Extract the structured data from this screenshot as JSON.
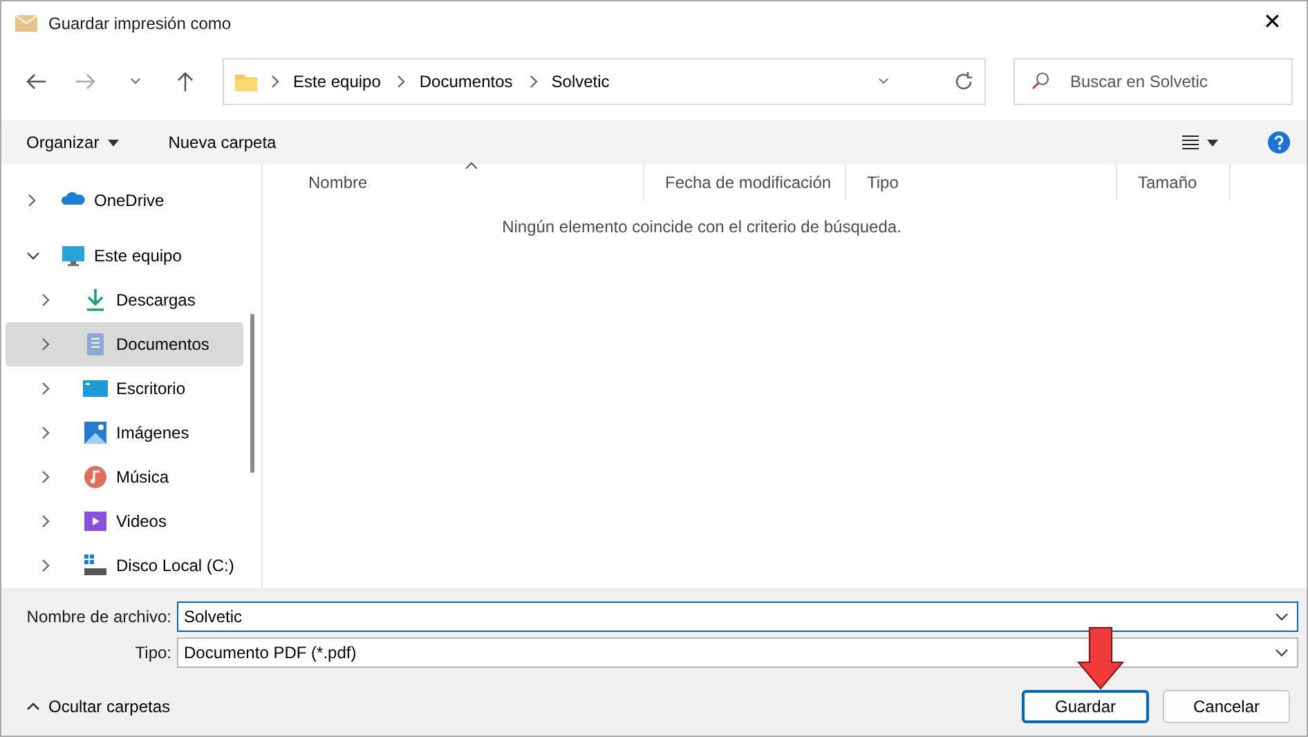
{
  "window": {
    "title": "Guardar impresión como",
    "close": "✕"
  },
  "breadcrumb": [
    "Este equipo",
    "Documentos",
    "Solvetic"
  ],
  "search": {
    "placeholder": "Buscar en Solvetic"
  },
  "toolbar": {
    "organize": "Organizar",
    "new_folder": "Nueva carpeta"
  },
  "sidebar": {
    "items": [
      {
        "label": "OneDrive",
        "expanded": false,
        "selected": false
      },
      {
        "label": "Este equipo",
        "expanded": true,
        "selected": false,
        "children": [
          {
            "label": "Descargas",
            "expanded": false,
            "selected": false
          },
          {
            "label": "Documentos",
            "expanded": false,
            "selected": true
          },
          {
            "label": "Escritorio",
            "expanded": false,
            "selected": false
          },
          {
            "label": "Imágenes",
            "expanded": false,
            "selected": false
          },
          {
            "label": "Música",
            "expanded": false,
            "selected": false
          },
          {
            "label": "Videos",
            "expanded": false,
            "selected": false
          },
          {
            "label": "Disco Local (C:)",
            "expanded": false,
            "selected": false
          }
        ]
      }
    ]
  },
  "table": {
    "columns": [
      {
        "label": "Nombre",
        "sorted": true
      },
      {
        "label": "Fecha de modificación",
        "sorted": false
      },
      {
        "label": "Tipo",
        "sorted": false
      },
      {
        "label": "Tamaño",
        "sorted": false
      }
    ],
    "empty_message": "Ningún elemento coincide con el criterio de búsqueda."
  },
  "form": [
    {
      "label": "Nombre de archivo:",
      "value": "Solvetic",
      "focused": true
    },
    {
      "label": "Tipo:",
      "value": "Documento PDF (*.pdf)",
      "focused": false
    }
  ],
  "footer": {
    "toggle": "Ocultar carpetas",
    "buttons": [
      {
        "label": "Guardar",
        "primary": true
      },
      {
        "label": "Cancelar",
        "primary": false
      }
    ]
  }
}
